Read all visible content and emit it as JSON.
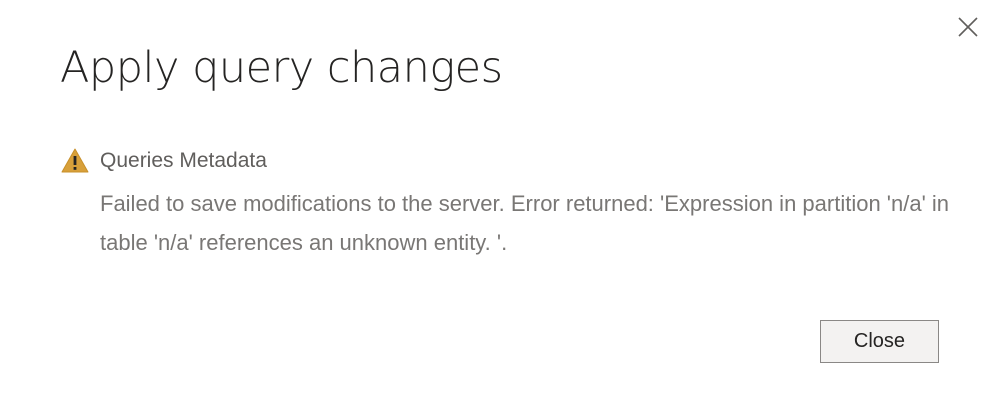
{
  "dialog": {
    "title": "Apply query changes",
    "close_icon": "close-icon"
  },
  "message": {
    "icon": "warning-icon",
    "icon_color": "#c19c00",
    "title": "Queries Metadata",
    "body": "Failed to save modifications to the server. Error returned: 'Expression in partition 'n/a' in table 'n/a' references an unknown entity. '."
  },
  "footer": {
    "close_button_label": "Close"
  }
}
